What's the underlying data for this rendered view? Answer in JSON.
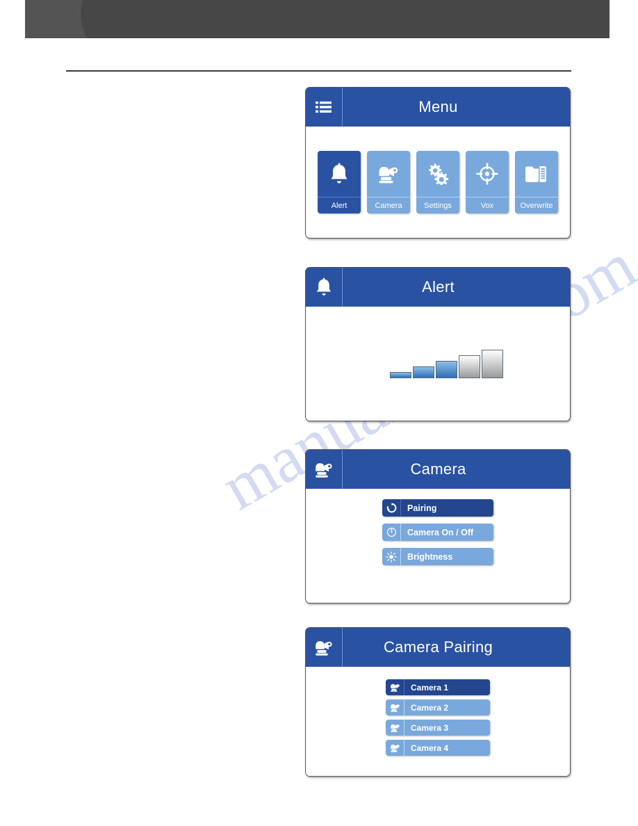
{
  "page": {
    "banner_style": "dark-gray-swoosh",
    "watermark_text": "manualshive.com",
    "accent_dark_blue": "#2a52a3",
    "accent_light_blue": "#79a8dc",
    "selected_blue": "#23468f",
    "banner_color": "#4b4b4b"
  },
  "screens": {
    "menu": {
      "header_icon": "hamburger-menu-icon",
      "title": "Menu",
      "tiles": [
        {
          "label": "Alert",
          "icon": "bell-icon",
          "selected": true
        },
        {
          "label": "Camera",
          "icon": "camera-icon",
          "selected": false
        },
        {
          "label": "Settings",
          "icon": "gears-icon",
          "selected": false
        },
        {
          "label": "Vox",
          "icon": "crosshair-icon",
          "selected": false
        },
        {
          "label": "Overwrite",
          "icon": "sd-card-folder-icon",
          "selected": false
        }
      ]
    },
    "alert": {
      "header_icon": "bell-icon",
      "title": "Alert",
      "volume_bars": [
        {
          "level": 1,
          "filled": true
        },
        {
          "level": 2,
          "filled": true
        },
        {
          "level": 3,
          "filled": true
        },
        {
          "level": 4,
          "filled": false
        },
        {
          "level": 5,
          "filled": false
        }
      ]
    },
    "camera": {
      "header_icon": "camera-icon",
      "title": "Camera",
      "buttons": [
        {
          "label": "Pairing",
          "icon": "pairing-refresh-icon",
          "selected": true
        },
        {
          "label": "Camera On / Off",
          "icon": "power-icon",
          "selected": false
        },
        {
          "label": "Brightness",
          "icon": "brightness-sun-icon",
          "selected": false
        }
      ]
    },
    "pairing": {
      "header_icon": "camera-icon",
      "title": "Camera Pairing",
      "buttons": [
        {
          "label": "Camera 1",
          "icon": "camera-icon",
          "selected": true
        },
        {
          "label": "Camera 2",
          "icon": "camera-icon",
          "selected": false
        },
        {
          "label": "Camera 3",
          "icon": "camera-icon",
          "selected": false
        },
        {
          "label": "Camera 4",
          "icon": "camera-icon",
          "selected": false
        }
      ]
    }
  }
}
